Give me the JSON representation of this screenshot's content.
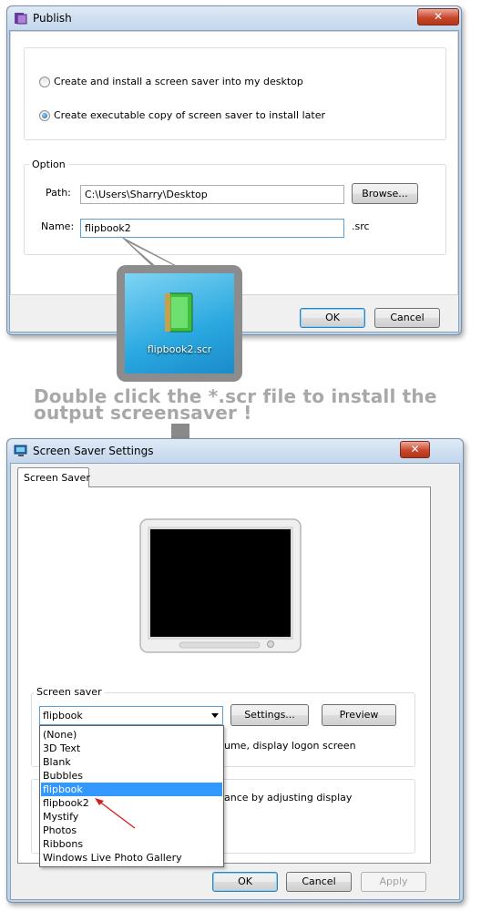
{
  "publish_dialog": {
    "title": "Publish",
    "close_label": "✕",
    "radio_install_label": "Create and install a screen saver into my desktop",
    "radio_executable_label": "Create executable copy of screen saver to install later",
    "option_group_label": "Option",
    "path_label": "Path:",
    "path_value": "C:\\Users\\Sharry\\Desktop",
    "browse_label": "Browse...",
    "name_label": "Name:",
    "name_value": "flipbook2",
    "name_suffix": ".src",
    "ok_label": "OK",
    "cancel_label": "Cancel"
  },
  "callout": {
    "file_name": "flipbook2.scr",
    "instruction_line1": "Double click the *.scr file to install the",
    "instruction_line2": "output screensaver !"
  },
  "screensaver_dialog": {
    "title": "Screen Saver Settings",
    "close_label": "✕",
    "tab_label": "Screen Saver",
    "group_label": "Screen saver",
    "selected_value": "flipbook",
    "settings_label": "Settings...",
    "preview_label": "Preview",
    "resume_text": "ume, display logon screen",
    "power_text": "ance by adjusting display",
    "dropdown_items": [
      "(None)",
      "3D Text",
      "Blank",
      "Bubbles",
      "flipbook",
      "flipbook2",
      "Mystify",
      "Photos",
      "Ribbons",
      "Windows Live Photo Gallery"
    ],
    "highlighted_item": "flipbook",
    "ok_label": "OK",
    "cancel_label": "Cancel",
    "apply_label": "Apply"
  }
}
